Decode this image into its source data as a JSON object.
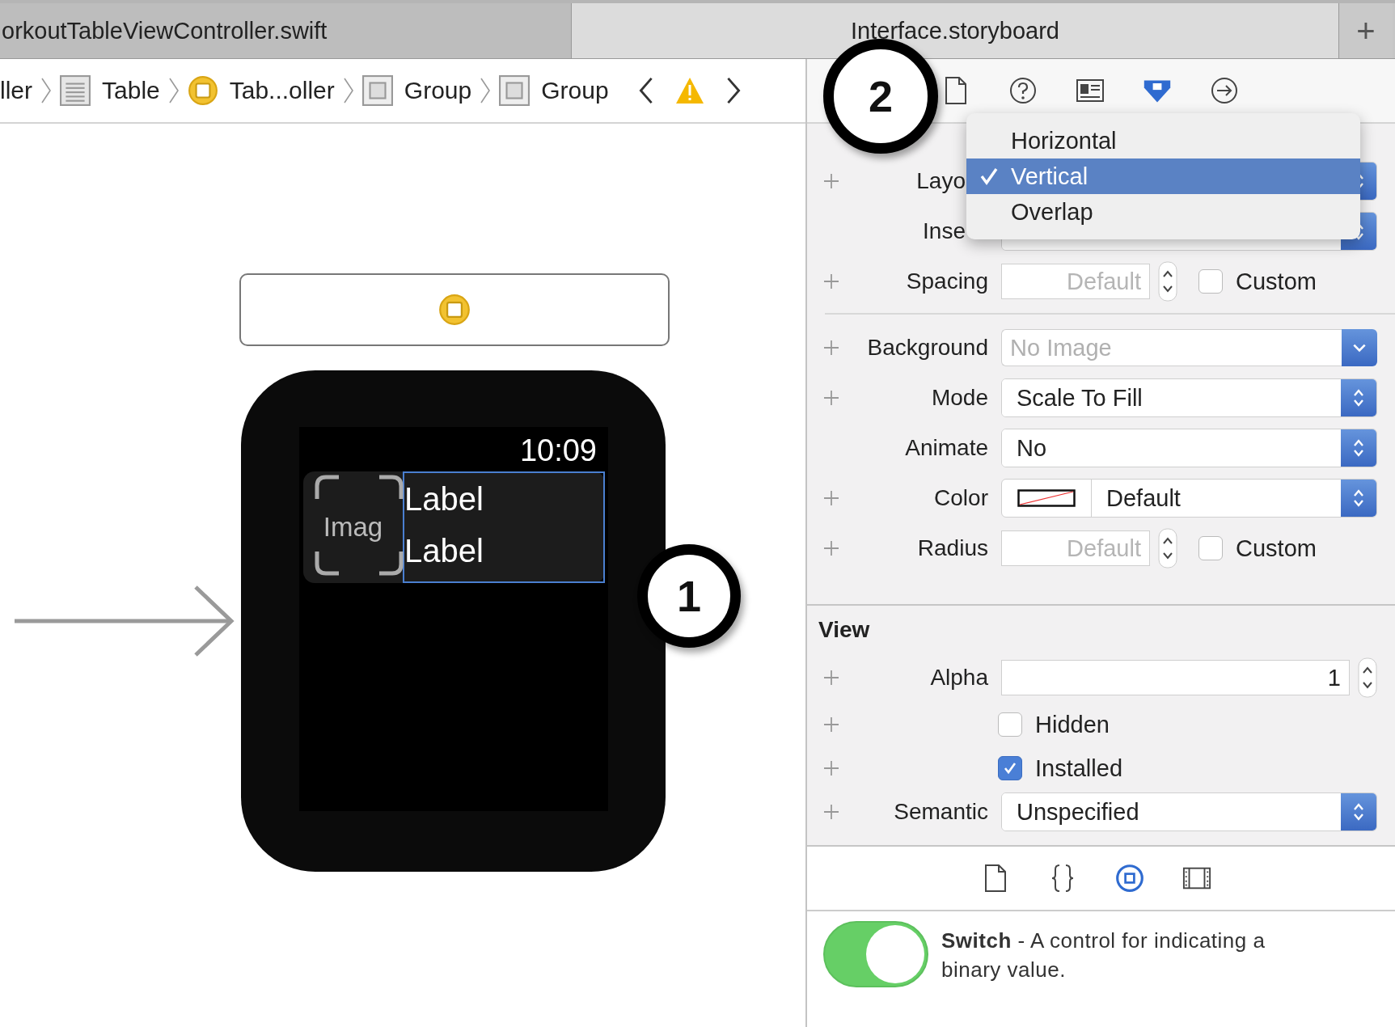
{
  "tabs": [
    {
      "label": "orkoutTableViewController.swift",
      "selected": false
    },
    {
      "label": "Interface.storyboard",
      "selected": true
    }
  ],
  "new_tab_button": "+",
  "breadcrumb": [
    {
      "kind": "text",
      "label": "ller"
    },
    {
      "kind": "table",
      "label": "Table"
    },
    {
      "kind": "controller",
      "label": "Tab...oller"
    },
    {
      "kind": "group",
      "label": "Group"
    },
    {
      "kind": "group",
      "label": "Group"
    }
  ],
  "canvas": {
    "time": "10:09",
    "image_placeholder": "Imag",
    "labels": [
      "Label",
      "Label"
    ]
  },
  "callouts": [
    "1",
    "2"
  ],
  "inspector": {
    "tabs": [
      {
        "kind": "file",
        "selected": false
      },
      {
        "kind": "help",
        "selected": false
      },
      {
        "kind": "identity",
        "selected": false
      },
      {
        "kind": "attributes",
        "selected": true
      },
      {
        "kind": "connections",
        "selected": false
      }
    ],
    "layout_menu": [
      {
        "label": "Horizontal",
        "selected": false
      },
      {
        "label": "Vertical",
        "selected": true
      },
      {
        "label": "Overlap",
        "selected": false
      }
    ],
    "sections": [
      {
        "rows": [
          {
            "kind": "covered",
            "label": "Layo",
            "variations": true
          },
          {
            "kind": "covered",
            "label": "Inse",
            "variations": false
          },
          {
            "kind": "stepper",
            "label": "Spacing",
            "placeholder": "Default",
            "option": {
              "label": "Custom",
              "checked": false
            },
            "variations": true
          }
        ]
      },
      {
        "rows": [
          {
            "kind": "combo",
            "label": "Background",
            "placeholder": "No Image",
            "variations": true
          },
          {
            "kind": "popup",
            "label": "Mode",
            "value": "Scale To Fill",
            "variations": true
          },
          {
            "kind": "popup",
            "label": "Animate",
            "value": "No",
            "variations": false
          },
          {
            "kind": "color",
            "label": "Color",
            "value": "Default",
            "variations": true
          },
          {
            "kind": "stepper",
            "label": "Radius",
            "placeholder": "Default",
            "option": {
              "label": "Custom",
              "checked": false
            },
            "variations": true
          }
        ]
      },
      {
        "title": "View",
        "rows": [
          {
            "kind": "number",
            "label": "Alpha",
            "value": "1",
            "variations": true
          },
          {
            "kind": "checkbox",
            "label": "Hidden",
            "checked": false,
            "variations": true
          },
          {
            "kind": "checkbox",
            "label": "Installed",
            "checked": true,
            "variations": true
          },
          {
            "kind": "popup",
            "label": "Semantic",
            "value": "Unspecified",
            "variations": true
          }
        ]
      }
    ]
  },
  "library": {
    "tabs": [
      {
        "kind": "file",
        "selected": false
      },
      {
        "kind": "code",
        "selected": false
      },
      {
        "kind": "object",
        "selected": true
      },
      {
        "kind": "media",
        "selected": false
      }
    ],
    "item": {
      "description": "**Switch** - A control for indicating a binary value.",
      "on": true
    }
  }
}
